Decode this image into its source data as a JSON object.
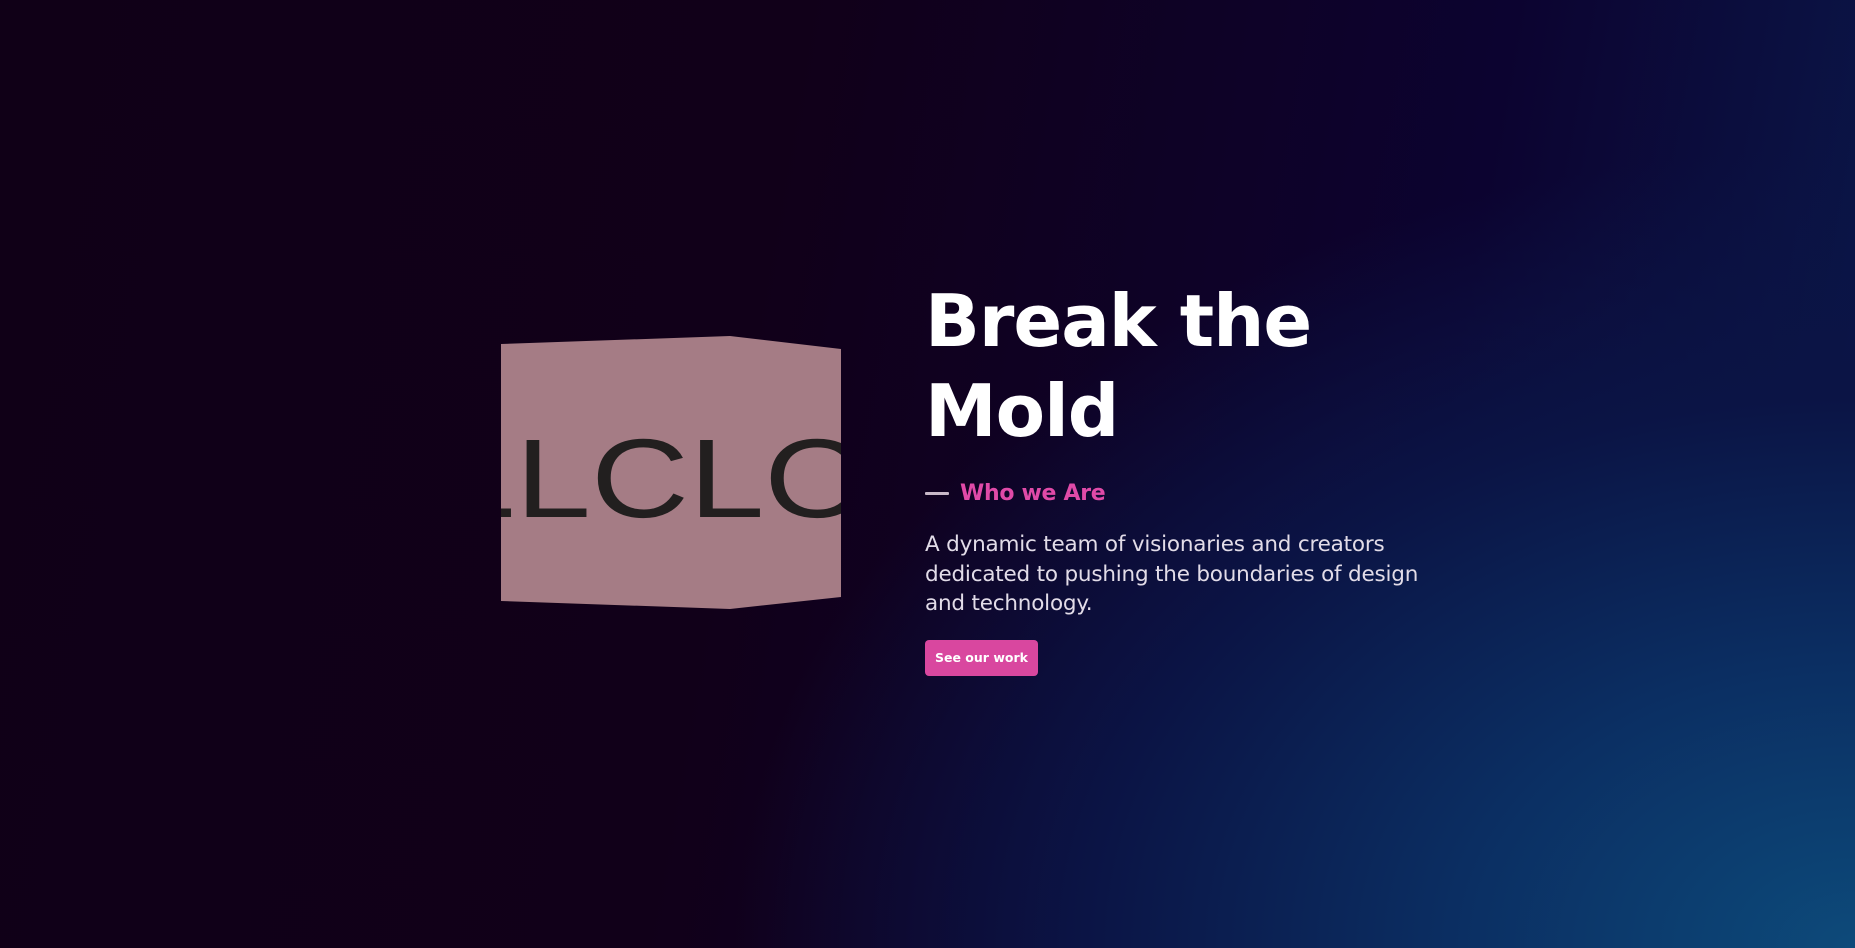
{
  "hero": {
    "cube_text": "LLCLO",
    "headline_line1": "Break the",
    "headline_line2": "Mold",
    "eyebrow": "Who we Are",
    "description": "A dynamic team of visionaries and creators dedicated to pushing the boundaries of design and technology.",
    "cta_label": "See our work"
  },
  "colors": {
    "accent": "#d9479f",
    "eyebrow": "#e04aa8",
    "cube_face": "#a57c85",
    "cube_text": "#221f1f",
    "background_dark": "#100017",
    "background_glow": "#0d4a7a"
  }
}
